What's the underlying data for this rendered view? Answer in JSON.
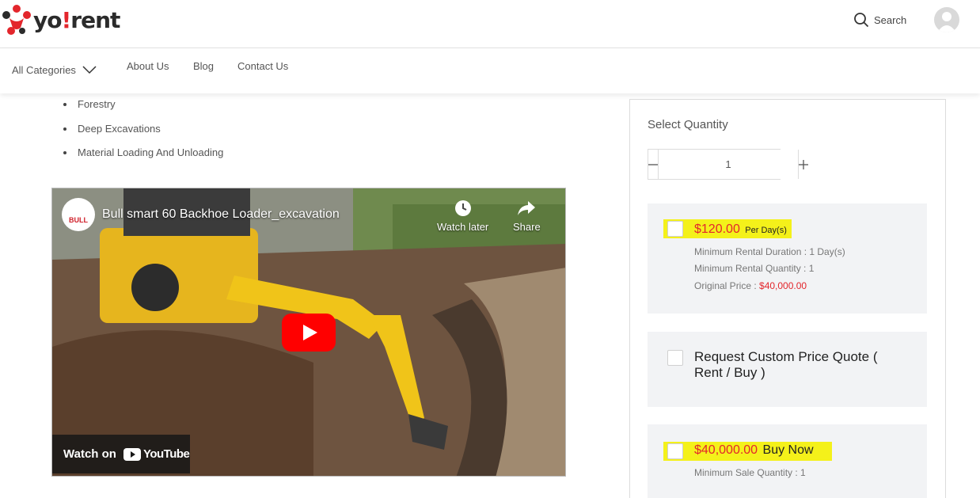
{
  "brand": {
    "name_prefix": "yo",
    "name_bang": "!",
    "name_suffix": "rent",
    "accent": "#e3262c"
  },
  "header": {
    "search_label": "Search"
  },
  "nav": {
    "categories_label": "All Categories",
    "links": [
      "About Us",
      "Blog",
      "Contact Us"
    ]
  },
  "uses": [
    "Forestry",
    "Deep Excavations",
    "Material Loading And Unloading"
  ],
  "video": {
    "title": "Bull smart 60 Backhoe Loader_excavation",
    "channel": "BULL",
    "watch_later": "Watch later",
    "share": "Share",
    "watch_on": "Watch on",
    "youtube": "YouTube"
  },
  "panel": {
    "select_quantity": "Select Quantity",
    "quantity": "1",
    "rent_option": {
      "price": "$120.00",
      "unit": "Per Day(s)",
      "min_duration": "Minimum Rental Duration : 1 Day(s)",
      "min_quantity": "Minimum Rental Quantity : 1",
      "original_label": "Original Price : ",
      "original_value": "$40,000.00"
    },
    "quote_option": {
      "label": "Request Custom Price Quote ( Rent / Buy )"
    },
    "buy_option": {
      "price": "$40,000.00",
      "label": "Buy Now",
      "min_sale": "Minimum Sale Quantity : 1"
    }
  },
  "colors": {
    "highlight": "#f4f11a",
    "price_red": "#e3262c",
    "option_bg": "#f2f3f5"
  }
}
